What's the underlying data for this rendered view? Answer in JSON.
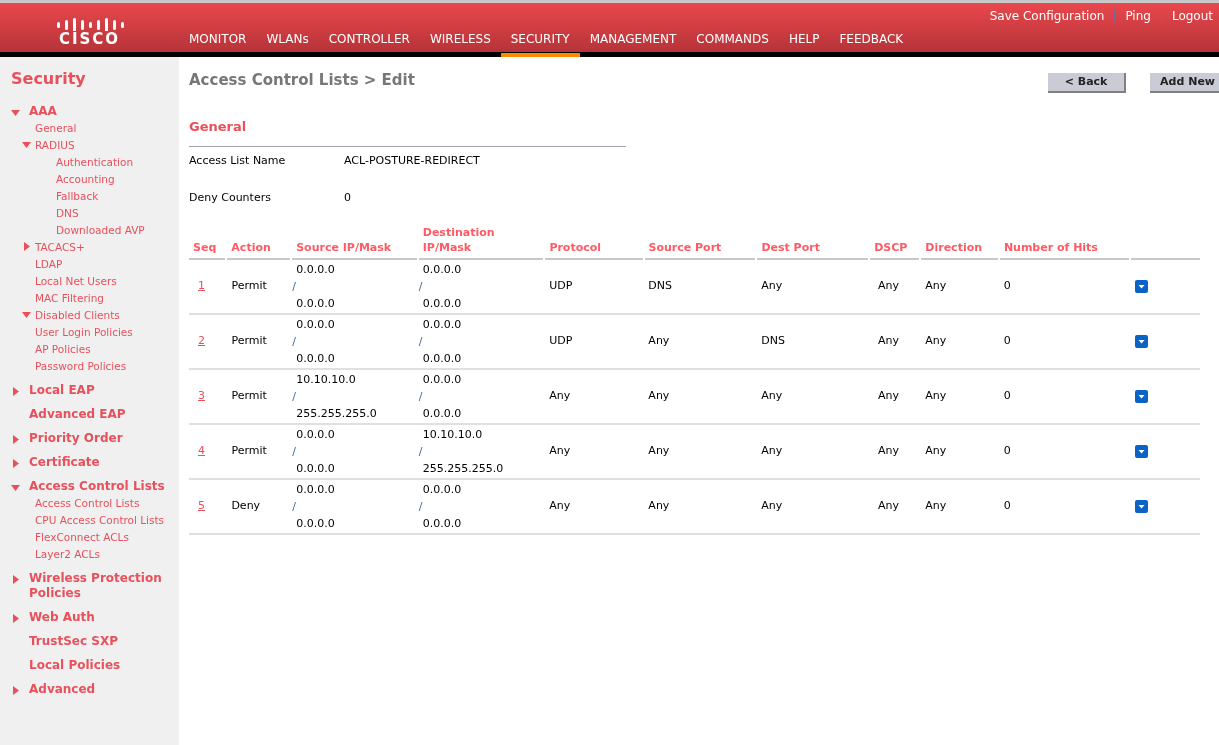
{
  "header": {
    "logo": "CISCO",
    "top_links": [
      "Save Configuration",
      "Ping",
      "Logout"
    ],
    "nav": [
      {
        "label": "MONITOR",
        "selected": false
      },
      {
        "label": "WLANs",
        "selected": false
      },
      {
        "label": "CONTROLLER",
        "selected": false
      },
      {
        "label": "WIRELESS",
        "selected": false
      },
      {
        "label": "SECURITY",
        "selected": true
      },
      {
        "label": "MANAGEMENT",
        "selected": false
      },
      {
        "label": "COMMANDS",
        "selected": false
      },
      {
        "label": "HELP",
        "selected": false
      },
      {
        "label": "FEEDBACK",
        "selected": false
      }
    ]
  },
  "sidebar": {
    "title": "Security",
    "items": [
      {
        "label": "AAA",
        "expanded": true,
        "children": [
          {
            "label": "General"
          },
          {
            "label": "RADIUS",
            "expanded": true,
            "children": [
              {
                "label": "Authentication"
              },
              {
                "label": "Accounting"
              },
              {
                "label": "Fallback"
              },
              {
                "label": "DNS"
              },
              {
                "label": "Downloaded AVP"
              }
            ]
          },
          {
            "label": "TACACS+",
            "expanded": false
          },
          {
            "label": "LDAP"
          },
          {
            "label": "Local Net Users"
          },
          {
            "label": "MAC Filtering"
          },
          {
            "label": "Disabled Clients",
            "expanded": true
          },
          {
            "label": "User Login Policies"
          },
          {
            "label": "AP Policies"
          },
          {
            "label": "Password Policies"
          }
        ]
      },
      {
        "label": "Local EAP",
        "expanded": false
      },
      {
        "label": "Advanced EAP"
      },
      {
        "label": "Priority Order",
        "expanded": false
      },
      {
        "label": "Certificate",
        "expanded": false
      },
      {
        "label": "Access Control Lists",
        "expanded": true,
        "children": [
          {
            "label": "Access Control Lists"
          },
          {
            "label": "CPU Access Control Lists"
          },
          {
            "label": "FlexConnect ACLs"
          },
          {
            "label": "Layer2 ACLs"
          }
        ]
      },
      {
        "label": "Wireless Protection Policies",
        "expanded": false
      },
      {
        "label": "Web Auth",
        "expanded": false
      },
      {
        "label": "TrustSec SXP"
      },
      {
        "label": "Local Policies"
      },
      {
        "label": "Advanced",
        "expanded": false
      }
    ]
  },
  "page": {
    "title": "Access Control Lists > Edit",
    "buttons": [
      "< Back",
      "Add New"
    ],
    "section": "General",
    "fields": [
      {
        "label": "Access List Name",
        "value": "ACL-POSTURE-REDIRECT"
      },
      {
        "label": "Deny Counters",
        "value": "0"
      }
    ]
  },
  "table": {
    "columns": [
      "Seq",
      "Action",
      "Source IP/Mask",
      "Destination IP/Mask",
      "Protocol",
      "Source Port",
      "Dest Port",
      "DSCP",
      "Direction",
      "Number of Hits"
    ],
    "rows": [
      {
        "seq": "1",
        "action": "Permit",
        "source_ip": "0.0.0.0",
        "source_sep": "/",
        "source_mask": "0.0.0.0",
        "dest_ip": "0.0.0.0",
        "dest_sep": "/",
        "dest_mask": "0.0.0.0",
        "protocol": "UDP",
        "source_port": "DNS",
        "dest_port": "Any",
        "dscp": "Any",
        "direction": "Any",
        "hits": "0"
      },
      {
        "seq": "2",
        "action": "Permit",
        "source_ip": "0.0.0.0",
        "source_sep": "/",
        "source_mask": "0.0.0.0",
        "dest_ip": "0.0.0.0",
        "dest_sep": "/",
        "dest_mask": "0.0.0.0",
        "protocol": "UDP",
        "source_port": "Any",
        "dest_port": "DNS",
        "dscp": "Any",
        "direction": "Any",
        "hits": "0"
      },
      {
        "seq": "3",
        "action": "Permit",
        "source_ip": "10.10.10.0",
        "source_sep": "/",
        "source_mask": "255.255.255.0",
        "dest_ip": "0.0.0.0",
        "dest_sep": "/",
        "dest_mask": "0.0.0.0",
        "protocol": "Any",
        "source_port": "Any",
        "dest_port": "Any",
        "dscp": "Any",
        "direction": "Any",
        "hits": "0"
      },
      {
        "seq": "4",
        "action": "Permit",
        "source_ip": "0.0.0.0",
        "source_sep": "/",
        "source_mask": "0.0.0.0",
        "dest_ip": "10.10.10.0",
        "dest_sep": "/",
        "dest_mask": "255.255.255.0",
        "protocol": "Any",
        "source_port": "Any",
        "dest_port": "Any",
        "dscp": "Any",
        "direction": "Any",
        "hits": "0"
      },
      {
        "seq": "5",
        "action": "Deny",
        "source_ip": "0.0.0.0",
        "source_sep": "/",
        "source_mask": "0.0.0.0",
        "dest_ip": "0.0.0.0",
        "dest_sep": "/",
        "dest_mask": "0.0.0.0",
        "protocol": "Any",
        "source_port": "Any",
        "dest_port": "Any",
        "dscp": "Any",
        "direction": "Any",
        "hits": "0"
      }
    ]
  }
}
